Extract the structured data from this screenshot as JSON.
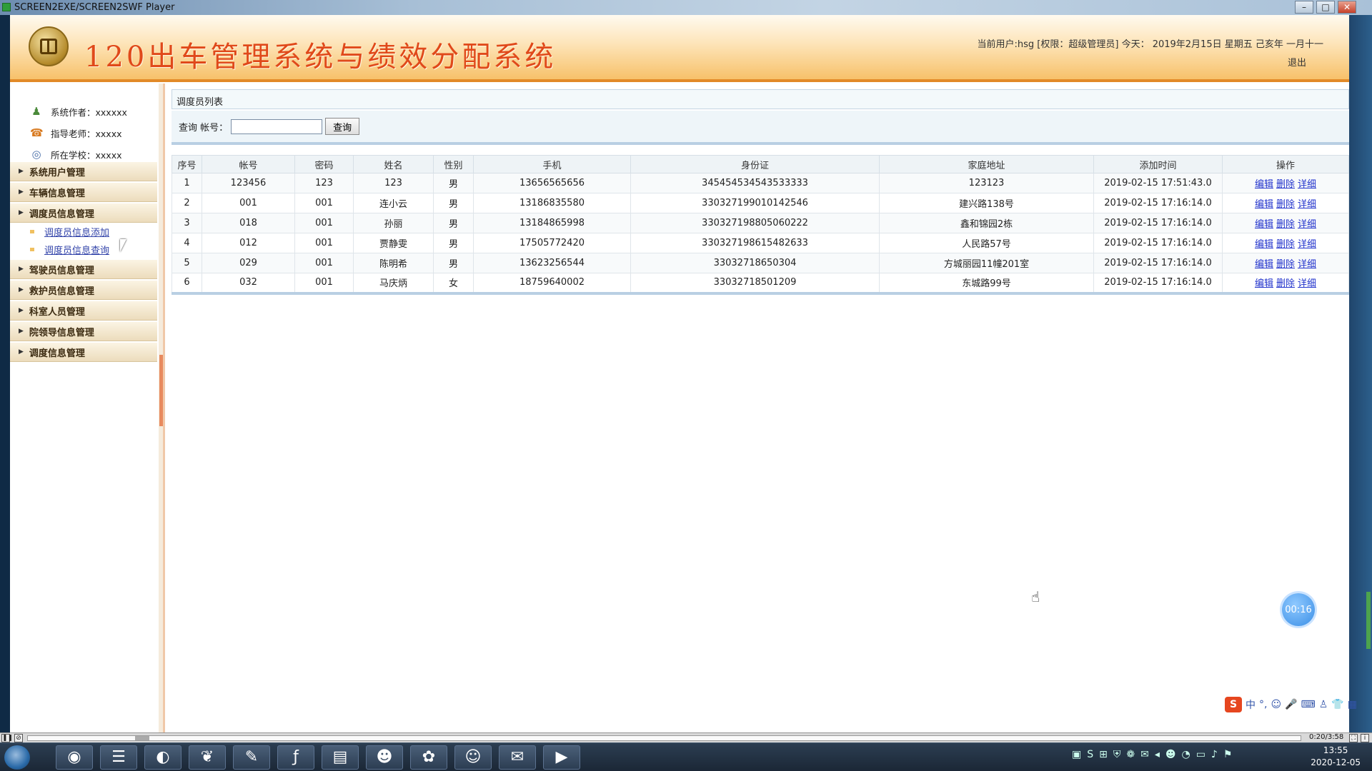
{
  "window": {
    "title": "SCREEN2EXE/SCREEN2SWF Player"
  },
  "header": {
    "system_title": "120出车管理系统与绩效分配系统",
    "user_info": "当前用户:hsg [权限：超级管理员] 今天： 2019年2月15日 星期五 己亥年 一月十一",
    "logout": "退出"
  },
  "sidebar": {
    "info": [
      {
        "label": "系统作者：xxxxxx",
        "icon": "author-icon"
      },
      {
        "label": "指导老师：xxxxx",
        "icon": "teacher-icon"
      },
      {
        "label": "所在学校：xxxxx",
        "icon": "school-icon"
      }
    ],
    "menus": [
      "系统用户管理",
      "车辆信息管理",
      "调度员信息管理",
      "驾驶员信息管理",
      "救护员信息管理",
      "科室人员管理",
      "院领导信息管理",
      "调度信息管理"
    ],
    "submenu": [
      "调度员信息添加",
      "调度员信息查询"
    ]
  },
  "content": {
    "breadcrumb": "调度员列表",
    "search": {
      "label": "查询 帐号：",
      "value": "",
      "button": "查询"
    },
    "table": {
      "headers": [
        "序号",
        "帐号",
        "密码",
        "姓名",
        "性别",
        "手机",
        "身份证",
        "家庭地址",
        "添加时间",
        "操作"
      ],
      "rows": [
        [
          "1",
          "123456",
          "123",
          "123",
          "男",
          "13656565656",
          "345454534543533333",
          "123123",
          "2019-02-15 17:51:43.0"
        ],
        [
          "2",
          "001",
          "001",
          "连小云",
          "男",
          "13186835580",
          "330327199010142546",
          "建兴路138号",
          "2019-02-15 17:16:14.0"
        ],
        [
          "3",
          "018",
          "001",
          "孙丽",
          "男",
          "13184865998",
          "330327198805060222",
          "鑫和锦园2栋",
          "2019-02-15 17:16:14.0"
        ],
        [
          "4",
          "012",
          "001",
          "贾静雯",
          "男",
          "17505772420",
          "330327198615482633",
          "人民路57号",
          "2019-02-15 17:16:14.0"
        ],
        [
          "5",
          "029",
          "001",
          "陈明希",
          "男",
          "13623256544",
          "33032718650304",
          "方城丽园11幢201室",
          "2019-02-15 17:16:14.0"
        ],
        [
          "6",
          "032",
          "001",
          "马庆炳",
          "女",
          "18759640002",
          "33032718501209",
          "东城路99号",
          "2019-02-15 17:16:14.0"
        ]
      ],
      "actions": [
        "编辑",
        "删除",
        "详细"
      ]
    }
  },
  "overlay": {
    "timer": "00:16",
    "ime": "中"
  },
  "player": {
    "time": "0:20/3:58"
  },
  "taskbar": {
    "apps": [
      "chrome-icon",
      "eclipse-icon",
      "browser-icon",
      "leaf-icon",
      "notes-icon",
      "flash-icon",
      "folder-icon",
      "qq-icon",
      "baidu-icon",
      "avatar-app-icon",
      "wechat-icon",
      "screen-recorder-icon"
    ],
    "clock_time": "13:55",
    "clock_date": "2020-12-05"
  },
  "colors": {
    "title_orange": "#e0491a",
    "link_blue": "#2233cc",
    "header_border": "#e28a28"
  }
}
